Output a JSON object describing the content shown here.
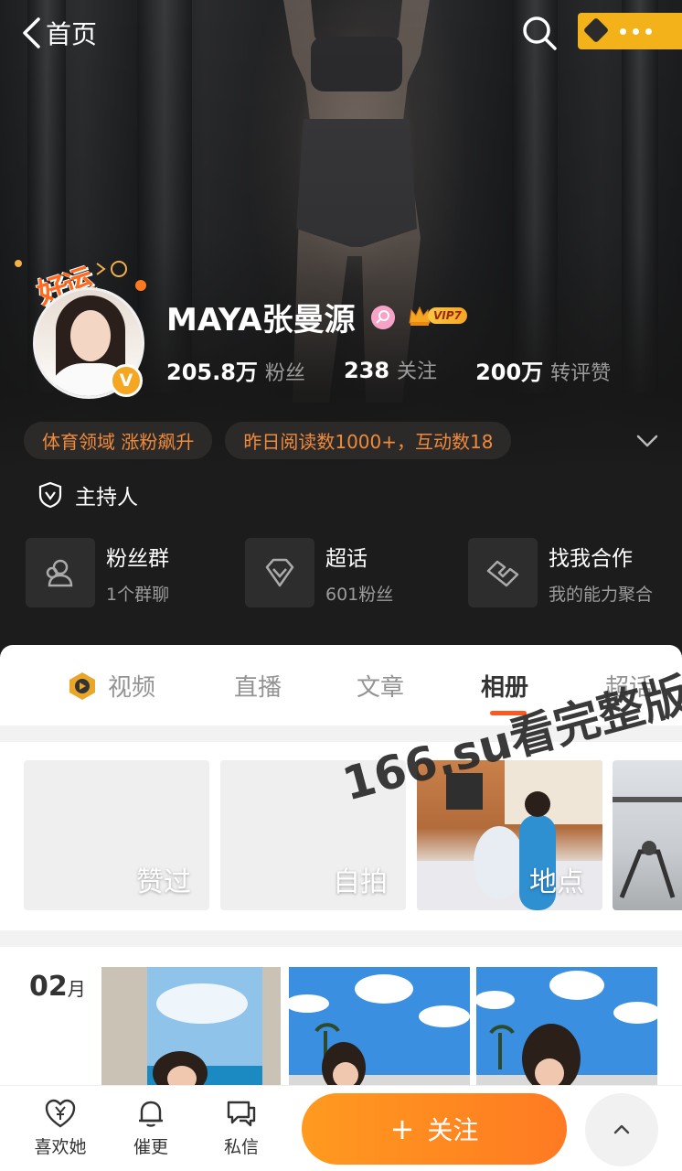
{
  "header": {
    "back_label": "首页"
  },
  "profile": {
    "name": "MAYA张曼源",
    "vip_label": "VIP7",
    "lucky_badge": "好运",
    "verified_mark": "V",
    "stats": [
      {
        "value": "205.8万",
        "label": "粉丝"
      },
      {
        "value": "238",
        "label": "关注"
      },
      {
        "value": "200万",
        "label": "转评赞"
      }
    ],
    "highlights": [
      "体育领域 涨粉飙升",
      "昨日阅读数1000+，互动数18"
    ],
    "role": "主持人",
    "features": [
      {
        "title": "粉丝群",
        "subtitle": "1个群聊",
        "icon": "group-icon"
      },
      {
        "title": "超话",
        "subtitle": "601粉丝",
        "icon": "diamond-icon"
      },
      {
        "title": "找我合作",
        "subtitle": "我的能力聚合",
        "icon": "handshake-icon"
      }
    ]
  },
  "tabs": [
    {
      "label": "视频",
      "active": false
    },
    {
      "label": "直播",
      "active": false
    },
    {
      "label": "文章",
      "active": false
    },
    {
      "label": "相册",
      "active": true
    },
    {
      "label": "超话",
      "active": false
    }
  ],
  "albums": [
    {
      "label": "赞过"
    },
    {
      "label": "自拍"
    },
    {
      "label": "地点"
    },
    {
      "label": ""
    }
  ],
  "timeline": {
    "month_number": "02",
    "month_unit": "月"
  },
  "watermark": "166.su看完整版",
  "bottom_bar": {
    "like_label": "喜欢她",
    "remind_label": "催更",
    "message_label": "私信",
    "follow_label": "关注"
  },
  "colors": {
    "accent": "#FF8A1F",
    "highlight_text": "#F08A3C",
    "vip_gold": "#F5A623",
    "tab_underline": "#FF5722"
  }
}
